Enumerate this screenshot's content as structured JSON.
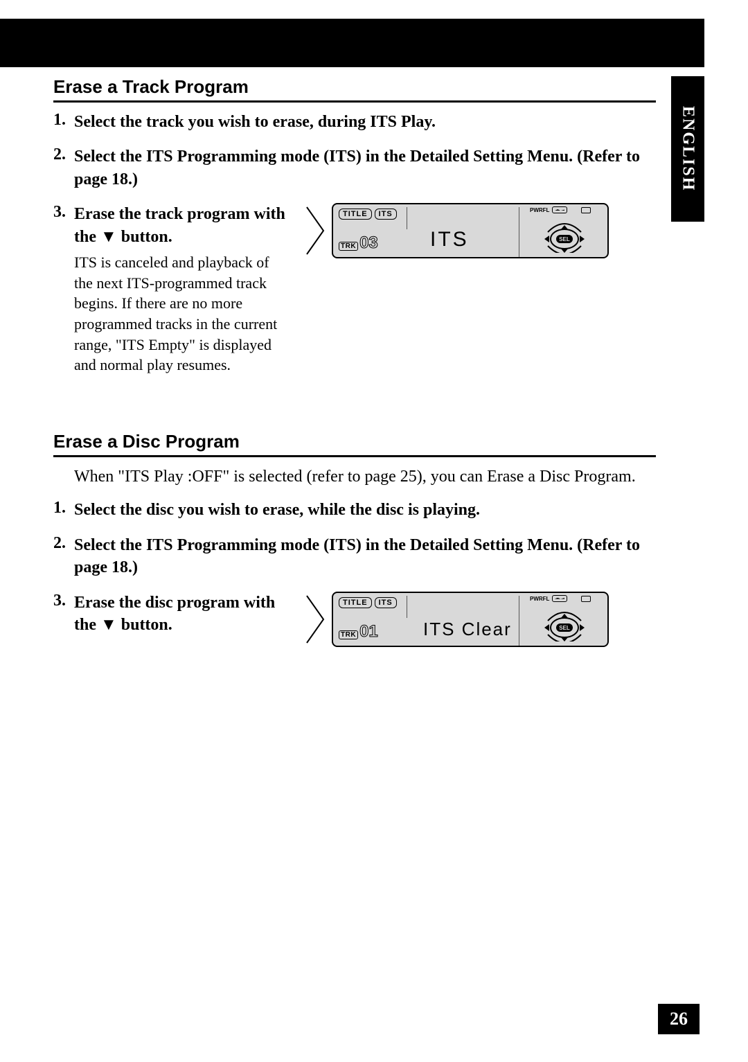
{
  "language": "ENGLISH",
  "page_number": "26",
  "section1": {
    "heading": "Erase a Track Program",
    "step1": "Select the track you wish to erase, during ITS Play.",
    "step2": "Select the ITS Programming mode (ITS) in the Detailed Setting Menu. (Refer to page 18.)",
    "step3_bold": "Erase the track program with the ▼ button.",
    "step3_note": "ITS is canceled and playback of the next ITS-programmed track begins. If there are no more programmed tracks in the current range, \"ITS Empty\" is displayed and normal play resumes.",
    "display": {
      "title_label": "TITLE",
      "its_label": "ITS",
      "trk_label": "TRK",
      "trk_num": "03",
      "main": "ITS",
      "pwrfl": "PWRFL",
      "sel": "SEL"
    }
  },
  "section2": {
    "heading": "Erase a Disc Program",
    "intro": "When \"ITS Play :OFF\" is selected (refer to page 25), you can Erase a Disc Program.",
    "step1": "Select the disc you wish to erase, while the disc is playing.",
    "step2": "Select the ITS Programming mode (ITS) in the Detailed Setting Menu. (Refer to page 18.)",
    "step3_bold": "Erase the disc program with the ▼ button.",
    "display": {
      "title_label": "TITLE",
      "its_label": "ITS",
      "trk_label": "TRK",
      "trk_num": "01",
      "main": "ITS Clear",
      "pwrfl": "PWRFL",
      "sel": "SEL"
    }
  }
}
